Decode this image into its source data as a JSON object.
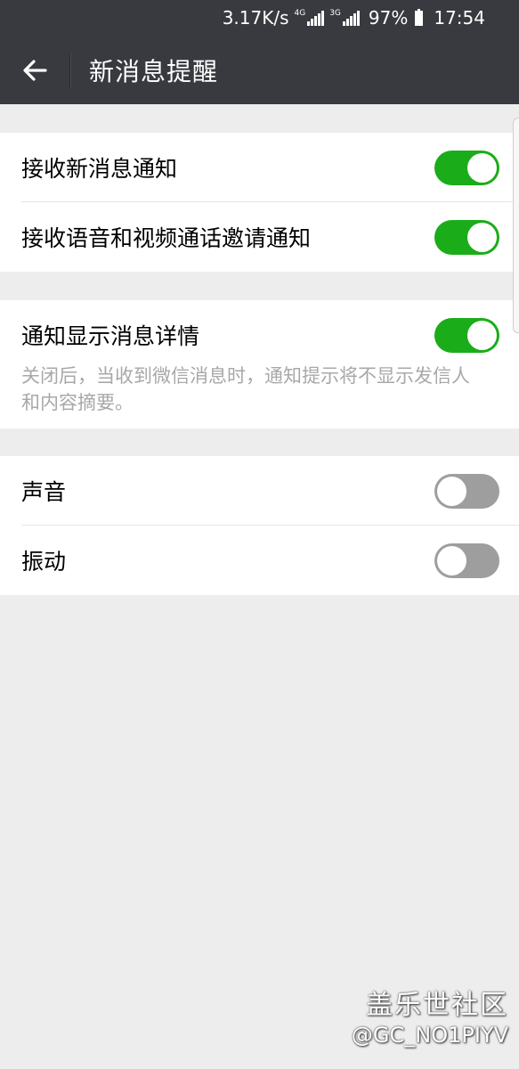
{
  "status_bar": {
    "speed": "3.17K/s",
    "network_1": "4G",
    "network_2": "3G",
    "battery": "97%",
    "time": "17:54"
  },
  "nav": {
    "back_icon": "back-arrow-icon",
    "title": "新消息提醒"
  },
  "groups": [
    {
      "items": [
        {
          "label": "接收新消息通知",
          "enabled": true
        },
        {
          "label": "接收语音和视频通话邀请通知",
          "enabled": true
        }
      ]
    },
    {
      "items": [
        {
          "label": "通知显示消息详情",
          "enabled": true
        }
      ],
      "description": "关闭后，当收到微信消息时，通知提示将不显示发信人和内容摘要。"
    },
    {
      "items": [
        {
          "label": "声音",
          "enabled": false
        },
        {
          "label": "振动",
          "enabled": false
        }
      ]
    }
  ],
  "colors": {
    "toolbar": "#393a3f",
    "toggle_on": "#1aad19",
    "toggle_off": "#9e9e9e",
    "background": "#ededed"
  },
  "watermark": {
    "site": "盖乐世社区",
    "user": "@GC_NO1PIYV"
  }
}
